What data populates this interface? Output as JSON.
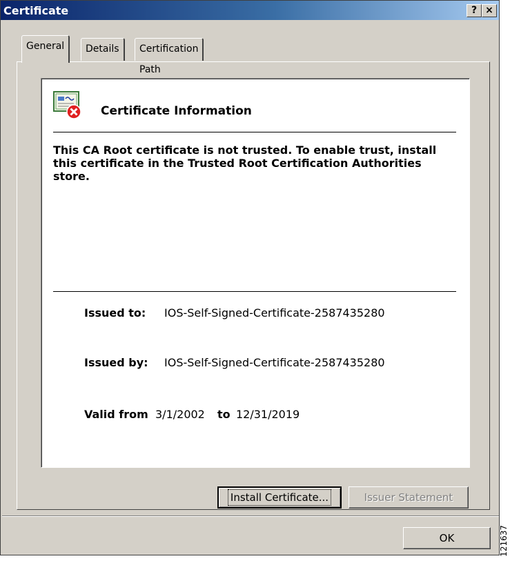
{
  "window": {
    "title": "Certificate",
    "help_label": "?",
    "close_label": "×"
  },
  "tabs": [
    {
      "label": "General",
      "active": true
    },
    {
      "label": "Details",
      "active": false
    },
    {
      "label": "Certification Path",
      "active": false
    }
  ],
  "info": {
    "icon": "certificate-error-icon",
    "heading": "Certificate Information",
    "message": "This CA Root certificate is not trusted. To enable trust, install this certificate in the Trusted Root Certification Authorities store.",
    "issued_to_label": "Issued to:",
    "issued_to_value": "IOS-Self-Signed-Certificate-2587435280",
    "issued_by_label": "Issued by:",
    "issued_by_value": "IOS-Self-Signed-Certificate-2587435280",
    "valid_from_label": "Valid from",
    "valid_from_value": "3/1/2002",
    "to_label": "to",
    "valid_to_value": "12/31/2019"
  },
  "buttons": {
    "install_certificate": "Install Certificate...",
    "issuer_statement": "Issuer Statement",
    "ok": "OK"
  },
  "watermark": "121637",
  "colors": {
    "titlebar_start": "#0a246a",
    "titlebar_end": "#a6caf0",
    "error_red": "#e02020",
    "face": "#d4d0c8"
  }
}
